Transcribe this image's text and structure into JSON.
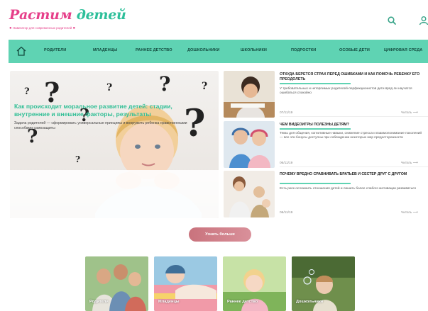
{
  "header": {
    "logo_part1": "Растим",
    "logo_part2": "детей",
    "tagline": "Навигатор для современных родителей"
  },
  "nav": {
    "items": [
      "РОДИТЕЛИ",
      "МЛАДЕНЦЫ",
      "РАННЕЕ ДЕТСТВО",
      "ДОШКОЛЬНИКИ",
      "ШКОЛЬНИКИ",
      "ПОДРОСТКИ",
      "ОСОБЫЕ ДЕТИ",
      "ЦИФРОВАЯ СРЕДА"
    ]
  },
  "hero": {
    "title": "Как происходит моральное развитие детей: стадии, внутренние и внешние факторы, результаты",
    "text": "Задача родителей — сформировать универсальные принципы и вооружить ребенка нравственными способами самозащиты"
  },
  "articles": [
    {
      "title": "ОТКУДА БЕРЕТСЯ СТРАХ ПЕРЕД ОШИБКАМИ И КАК ПОМОЧЬ РЕБЕНКУ ЕГО ПРЕОДОЛЕТЬ",
      "text": "У требовательных и нетерпимых родителей-перфекционистов дети вряд ли научатся ошибаться спокойно",
      "date": "07/11/19",
      "read": "Читать"
    },
    {
      "title": "ЧЕМ ВИДЕОИГРЫ ПОЛЕЗНЫ ДЕТЯМ?",
      "text": "Темы для общения, когнитивные навыки, снижение стресса и взаимопонимание поколений — все эти бонусы доступны при соблюдении некоторых мер предосторожности",
      "date": "06/11/19",
      "read": "Читать"
    },
    {
      "title": "ПОЧЕМУ ВРЕДНО СРАВНИВАТЬ БРАТЬЕВ И СЕСТЕР ДРУГ С ДРУГОМ",
      "text": "Есть риск осложнить отношения детей и лишить более слабого мотивации развиваться",
      "date": "06/11/19",
      "read": "Читать"
    }
  ],
  "more_button": "Узнать больше",
  "categories": [
    "Родители",
    "Младенцы",
    "Раннее детство",
    "Дошкольники"
  ],
  "colors": {
    "brand_pink": "#e6408a",
    "brand_green": "#5fd3b3",
    "button_rose": "#c9737d"
  },
  "icons": {
    "search": "search-icon",
    "user": "user-icon",
    "home": "home-icon",
    "read_arrow": "arrow-right-icon"
  }
}
